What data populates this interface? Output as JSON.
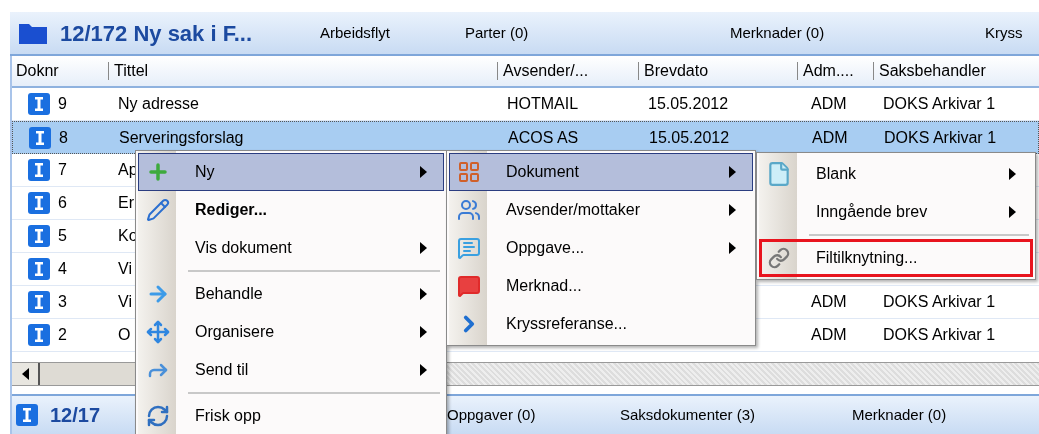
{
  "header": {
    "title": "12/172 Ny sak i F...",
    "tabs": [
      "Arbeidsflyt",
      "Parter (0)",
      "Merknader (0)",
      "Kryss"
    ]
  },
  "table": {
    "columns": [
      "Doknr",
      "Tittel",
      "Avsender/...",
      "Brevdato",
      "Adm....",
      "Saksbehandler"
    ],
    "rows": [
      {
        "doknr": "9",
        "title": "Ny adresse",
        "sender": "HOTMAIL",
        "date": "15.05.2012",
        "adm": "ADM",
        "handler": "DOKS Arkivar 1",
        "selected": false
      },
      {
        "doknr": "8",
        "title": "Serveringsforslag",
        "sender": "ACOS AS",
        "date": "15.05.2012",
        "adm": "ADM",
        "handler": "DOKS Arkivar 1",
        "selected": true
      },
      {
        "doknr": "7",
        "title": "Ap",
        "selected": false
      },
      {
        "doknr": "6",
        "title": "Er",
        "selected": false
      },
      {
        "doknr": "5",
        "title": "Ko",
        "selected": false
      },
      {
        "doknr": "4",
        "title": "Vi",
        "selected": false
      },
      {
        "doknr": "3",
        "title": "Vi",
        "adm": "ADM",
        "handler": "DOKS Arkivar 1",
        "selected": false
      },
      {
        "doknr": "2",
        "title": "O",
        "adm": "ADM",
        "handler": "DOKS Arkivar 1",
        "selected": false
      }
    ]
  },
  "context_menu": {
    "items": [
      {
        "kind": "item",
        "label": "Ny",
        "bold": false,
        "submenu": true,
        "selected": true
      },
      {
        "kind": "item",
        "label": "Rediger...",
        "bold": true,
        "submenu": false,
        "selected": false
      },
      {
        "kind": "item",
        "label": "Vis dokument",
        "bold": false,
        "submenu": true,
        "selected": false
      },
      {
        "kind": "separator"
      },
      {
        "kind": "item",
        "label": "Behandle",
        "bold": false,
        "submenu": true,
        "selected": false
      },
      {
        "kind": "item",
        "label": "Organisere",
        "bold": false,
        "submenu": true,
        "selected": false
      },
      {
        "kind": "item",
        "label": "Send til",
        "bold": false,
        "submenu": true,
        "selected": false
      },
      {
        "kind": "separator"
      },
      {
        "kind": "item",
        "label": "Frisk opp",
        "bold": false,
        "submenu": false,
        "selected": false
      }
    ]
  },
  "submenu": {
    "items": [
      {
        "kind": "item",
        "label": "Dokument",
        "submenu": true,
        "selected": true
      },
      {
        "kind": "item",
        "label": "Avsender/mottaker",
        "submenu": true,
        "selected": false
      },
      {
        "kind": "item",
        "label": "Oppgave...",
        "submenu": true,
        "selected": false
      },
      {
        "kind": "item",
        "label": "Merknad...",
        "submenu": false,
        "selected": false
      },
      {
        "kind": "item",
        "label": "Kryssreferanse...",
        "submenu": false,
        "selected": false
      }
    ]
  },
  "submenu_2": {
    "items": [
      {
        "kind": "item",
        "label": "Blank",
        "submenu": true,
        "marked": false
      },
      {
        "kind": "item",
        "label": "Inngående brev",
        "submenu": true,
        "marked": false
      },
      {
        "kind": "separator"
      },
      {
        "kind": "item",
        "label": "Filtilknytning...",
        "submenu": false,
        "marked": true
      }
    ]
  },
  "bottom_panel": {
    "title": "12/17",
    "tabs": [
      "Oppgaver (0)",
      "Saksdokumenter (3)",
      "Merknader (0)"
    ]
  }
}
